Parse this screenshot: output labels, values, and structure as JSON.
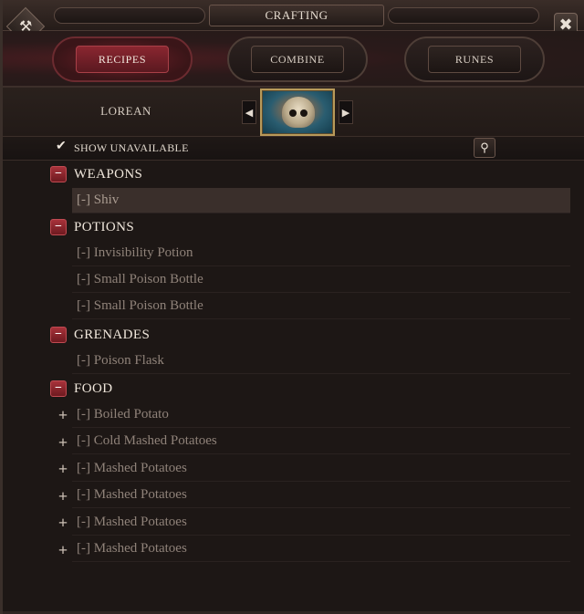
{
  "title": "CRAFTING",
  "tabs": [
    {
      "label": "RECIPES",
      "active": true
    },
    {
      "label": "COMBINE",
      "active": false
    },
    {
      "label": "RUNES",
      "active": false
    }
  ],
  "character": {
    "name": "LOREAN"
  },
  "filter": {
    "label": "SHOW UNAVAILABLE",
    "checked": true
  },
  "categories": [
    {
      "label": "WEAPONS",
      "items": [
        "[-] Shiv"
      ]
    },
    {
      "label": "POTIONS",
      "items": [
        "[-] Invisibility Potion",
        "[-] Small Poison Bottle",
        "[-] Small Poison Bottle"
      ]
    },
    {
      "label": "GRENADES",
      "items": [
        "[-] Poison Flask"
      ]
    },
    {
      "label": "FOOD",
      "items": [
        "[-] Boiled Potato",
        "[-] Cold Mashed Potatoes",
        "[-] Mashed Potatoes",
        "[-] Mashed Potatoes",
        "[-] Mashed Potatoes",
        "[-] Mashed Potatoes"
      ]
    }
  ],
  "icons": {
    "left_corner": "hammer-icon",
    "close": "close-icon",
    "prev": "chevron-left-icon",
    "next": "chevron-right-icon",
    "search": "magnifier-icon",
    "check": "checkmark-icon",
    "collapse": "minus-icon",
    "expand": "plus-icon"
  },
  "colors": {
    "accent": "#8a2630",
    "background": "#1d1715",
    "selected_row": "#3a2f2b"
  }
}
